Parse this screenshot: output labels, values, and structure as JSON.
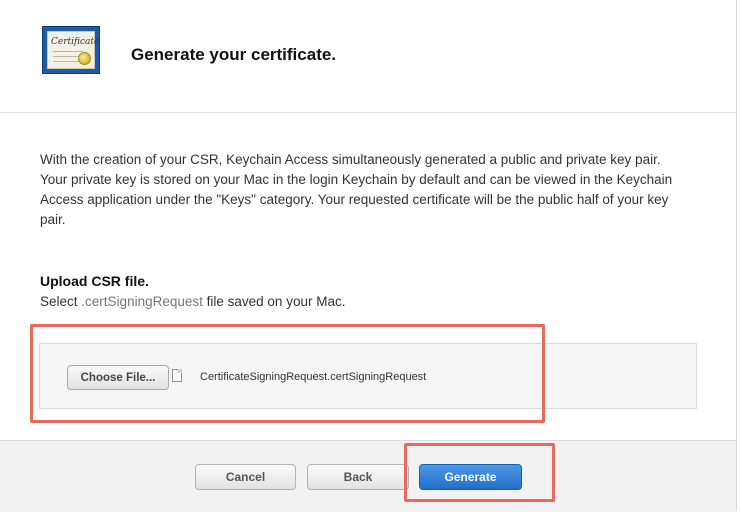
{
  "header": {
    "icon": "certificate-icon",
    "icon_text": "Certificate",
    "title": "Generate your certificate."
  },
  "description": "With the creation of your CSR, Keychain Access simultaneously generated a public and private key pair. Your private key is stored on your Mac in the login Keychain by default and can be viewed in the Keychain Access application under the \"Keys\" category. Your requested certificate will be the public half of your key pair.",
  "upload": {
    "title": "Upload CSR file.",
    "sub_prefix": "Select",
    "sub_ext": ".certSigningRequest",
    "sub_suffix": "file saved on your Mac.",
    "choose_label": "Choose File...",
    "file_icon": "document-icon",
    "file_name": "CertificateSigningRequest.certSigningRequest"
  },
  "footer": {
    "cancel_label": "Cancel",
    "back_label": "Back",
    "generate_label": "Generate"
  },
  "colors": {
    "primary": "#1f6fcb",
    "highlight": "#e8695f"
  }
}
